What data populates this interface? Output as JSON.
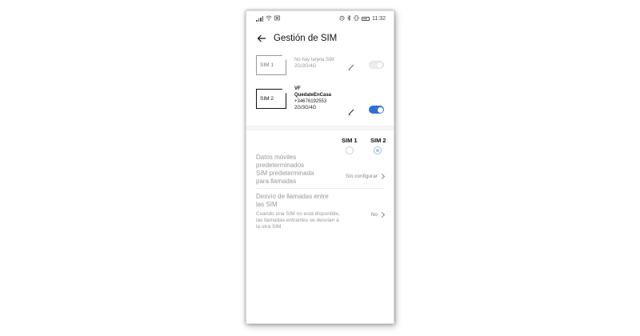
{
  "status_bar": {
    "left_icons": [
      "signal-icon",
      "wifi-icon",
      "screenshot-icon"
    ],
    "right_icons": [
      "alarm-icon",
      "bluetooth-icon",
      "vibrate-icon",
      "battery-icon"
    ],
    "time": "11:32"
  },
  "header": {
    "back_icon": "arrow-left-icon",
    "title": "Gestión de SIM"
  },
  "sims": [
    {
      "card_label": "SIM 1",
      "line1": "No hay tarjeta SIM",
      "line2": "",
      "line3": "2G/3G/4G",
      "enabled": false
    },
    {
      "card_label": "SIM 2",
      "line1": "VF",
      "line2": "QuedateEnCasa",
      "line3": "+34676192553",
      "line4": "2G/3G/4G",
      "enabled": true
    }
  ],
  "columns": {
    "sim1": "SIM 1",
    "sim2": "SIM 2"
  },
  "settings": {
    "default_data": {
      "label": "Datos móviles predeterminados",
      "selected": "SIM 2"
    },
    "default_calls": {
      "label": "SIM predeterminada para llamadas",
      "value": "Sin configurar"
    },
    "call_forwarding": {
      "label": "Desvío de llamadas entre las SIM",
      "description": "Cuando una SIM no está disponible, las llamadas entrantes se desvían a la otra SIM.",
      "value": "No"
    }
  },
  "colors": {
    "accent": "#2f6fd6",
    "disabled_text": "#999999"
  }
}
